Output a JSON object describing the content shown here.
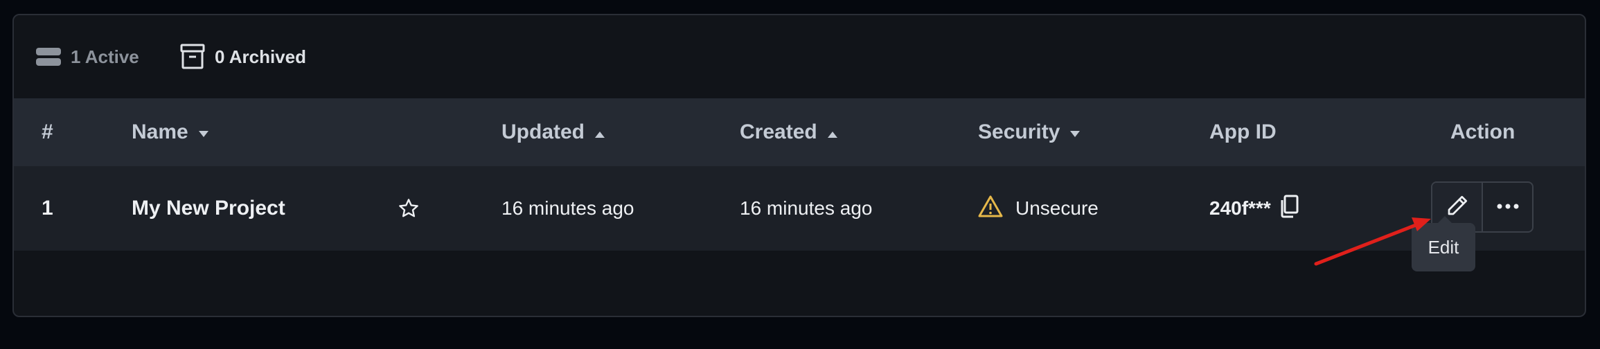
{
  "tabs": {
    "active": {
      "label": "1 Active",
      "icon": "stack-icon"
    },
    "archived": {
      "label": "0 Archived",
      "icon": "archive-box-icon"
    }
  },
  "table": {
    "columns": [
      {
        "label": "#"
      },
      {
        "label": "Name",
        "sort": "desc"
      },
      {
        "label": "Updated",
        "sort": "asc"
      },
      {
        "label": "Created",
        "sort": "asc"
      },
      {
        "label": "Security",
        "sort": "desc"
      },
      {
        "label": "App ID"
      },
      {
        "label": "Action"
      }
    ],
    "rows": [
      {
        "index": "1",
        "name": "My New Project",
        "updated": "16 minutes ago",
        "created": "16 minutes ago",
        "security": "Unsecure",
        "app_id": "240f***"
      }
    ]
  },
  "tooltip": {
    "text": "Edit"
  },
  "colors": {
    "background": "#05080e",
    "panel": "#111419",
    "header": "#252a33",
    "row": "#1c2027",
    "warning": "#e6b84a",
    "annotation_arrow": "#e0201b"
  }
}
